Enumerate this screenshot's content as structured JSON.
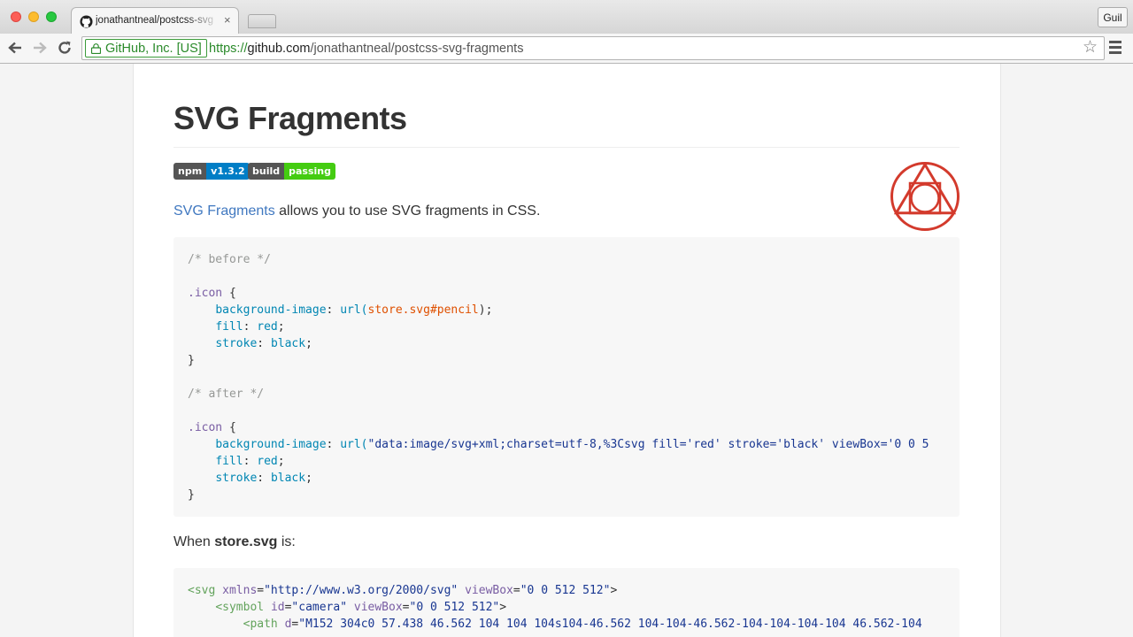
{
  "browser": {
    "tab_title": "jonathantneal/postcss-svg",
    "tab_close": "×",
    "profile": "Guil",
    "ev_label": "GitHub, Inc. [US]",
    "url_scheme": "https://",
    "url_host": "github.com",
    "url_path": "/jonathantneal/postcss-svg-fragments",
    "star": "☆"
  },
  "page": {
    "title": "SVG Fragments",
    "badges": [
      {
        "left": "npm",
        "right": "v1.3.2",
        "right_color": "#007ec6"
      },
      {
        "left": "build",
        "right": "passing",
        "right_color": "#44cc11"
      }
    ],
    "intro_link": "SVG Fragments",
    "intro_rest": " allows you to use SVG fragments in CSS.",
    "when_prefix": "When ",
    "when_strong": "store.svg",
    "when_suffix": " is:"
  },
  "code_before": {
    "comment": "/* before */",
    "selector": ".icon",
    "open": " {",
    "prop1": "background-image",
    "fn": "url(",
    "url": "store.svg#pencil",
    "close_fn": ");",
    "prop2": "fill",
    "val2": "red",
    "prop3": "stroke",
    "val3": "black",
    "brace_close": "}"
  },
  "code_after": {
    "comment": "/* after */",
    "selector": ".icon",
    "open": " {",
    "prop1": "background-image",
    "fn": "url(",
    "data_uri": "\"data:image/svg+xml;charset=utf-8,%3Csvg fill='red' stroke='black' viewBox='0 0 5",
    "prop2": "fill",
    "val2": "red",
    "prop3": "stroke",
    "val3": "black",
    "brace_close": "}"
  },
  "code_svg": {
    "line1_tag": "<svg",
    "line1_attr1": "xmlns",
    "line1_val1": "\"http://www.w3.org/2000/svg\"",
    "line1_attr2": "viewBox",
    "line1_val2": "\"0 0 512 512\"",
    "line2_tag": "<symbol",
    "line2_attr1": "id",
    "line2_val1": "\"camera\"",
    "line2_attr2": "viewBox",
    "line2_val2": "\"0 0 512 512\"",
    "line3_tag": "<path",
    "line3_attr1": "d",
    "line3_val1": "\"M152 304c0 57.438 46.562 104 104 104s104-46.562 104-104-46.562-104-104-104-104 46.562-104"
  },
  "colors": {
    "link": "#4078c0",
    "ev_green": "#2a8a2a",
    "logo_red": "#d33a2c"
  }
}
